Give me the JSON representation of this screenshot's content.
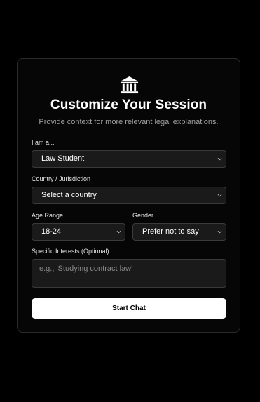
{
  "header": {
    "logo_icon": "bank-building-icon",
    "title": "Customize Your Session",
    "subtitle": "Provide context for more relevant legal explanations."
  },
  "form": {
    "role": {
      "label": "I am a...",
      "value": "Law Student"
    },
    "country": {
      "label": "Country / Jurisdiction",
      "value": "Select a country"
    },
    "age": {
      "label": "Age Range",
      "value": "18-24"
    },
    "gender": {
      "label": "Gender",
      "value": "Prefer not to say"
    },
    "interests": {
      "label": "Specific Interests (Optional)",
      "placeholder": "e.g., 'Studying contract law'"
    },
    "submit_label": "Start Chat"
  },
  "colors": {
    "background": "#000000",
    "card": "#060606",
    "field": "#1a1a1a",
    "button": "#ffffff"
  }
}
